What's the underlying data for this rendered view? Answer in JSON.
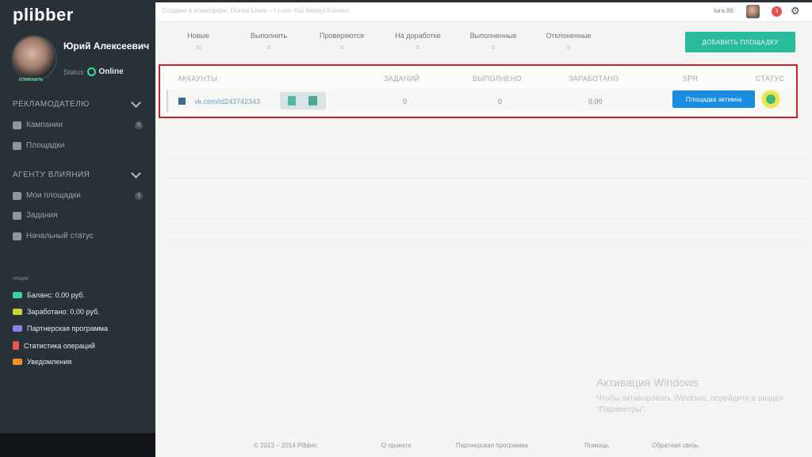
{
  "app": {
    "logo": "plibber"
  },
  "header": {
    "crumb": "Создано в атмосфере: Donna Lewis – I Love You Always Forever.",
    "user_name": "Iura.86",
    "notifications": "3"
  },
  "profile": {
    "name": "Юрий Алексеевич",
    "status_label": "Status",
    "status_value": "Online",
    "avatar_link": "изменить"
  },
  "sidebar": {
    "advertiser_title": "РЕКЛАМОДАТЕЛЮ",
    "advertiser_items": [
      {
        "label": "Кампании",
        "icon": "megaphone-icon",
        "badge": "0"
      },
      {
        "label": "Площадки",
        "icon": "list-icon"
      }
    ],
    "agent_title": "АГЕНТУ ВЛИЯНИЯ",
    "agent_items": [
      {
        "label": "Мои площадки",
        "icon": "thumbs-up-icon",
        "badge": "1"
      },
      {
        "label": "Задания",
        "icon": "document-icon"
      },
      {
        "label": "Начальный статус",
        "icon": "user-icon"
      }
    ],
    "options_title": "опции",
    "options": [
      {
        "label": "Баланс: 0,00 руб.",
        "icon": "wallet-icon",
        "color": "#3ecf9f"
      },
      {
        "label": "Заработано: 0,00 руб.",
        "icon": "money-icon",
        "color": "#c9d43a"
      },
      {
        "label": "Партнерская программа",
        "icon": "handshake-icon",
        "color": "#8a84e8"
      },
      {
        "label": "Статистика операций",
        "icon": "flask-icon",
        "color": "#e8584a"
      },
      {
        "label": "Уведомления",
        "icon": "mail-icon",
        "color": "#f0922c"
      }
    ]
  },
  "tabs": [
    {
      "label": "Новые",
      "count": "10"
    },
    {
      "label": "Выполнить",
      "count": "0"
    },
    {
      "label": "Проверяются",
      "count": "0"
    },
    {
      "label": "На доработке",
      "count": "0"
    },
    {
      "label": "Выполненные",
      "count": "0"
    },
    {
      "label": "Отклоненные",
      "count": "0"
    }
  ],
  "add_button": "ДОБАВИТЬ ПЛОЩАДКУ",
  "table": {
    "headers": [
      "АККАУНТЫ",
      "ЗАДАНИЙ",
      "ВЫПОЛНЕНО",
      "ЗАРАБОТАНО",
      "SPR",
      "СТАТУС"
    ],
    "row": {
      "account": "vk.com/id243742343",
      "tasks": "0",
      "done": "0",
      "earned": "0,00",
      "status_button": "Площадка активна"
    }
  },
  "watermark": {
    "title": "Активация Windows",
    "text": "Чтобы активировать Windows, перейдите в раздел \"Параметры\"."
  },
  "footer": {
    "copyright": "© 2013 – 2014 Plibber.",
    "links": [
      "О проекте",
      "Партнерская программа",
      "Помощь",
      "Обратная связь"
    ]
  },
  "colors": {
    "accent": "#28bc9c",
    "primary": "#1a8ce0",
    "highlight": "#d0202c",
    "sidebar": "#283038"
  }
}
